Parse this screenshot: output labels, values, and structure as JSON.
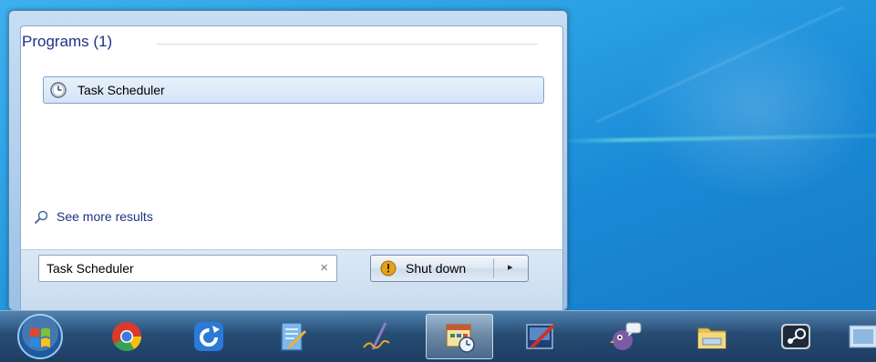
{
  "search_panel": {
    "group_title": "Programs (1)",
    "results": [
      {
        "label": "Task Scheduler",
        "icon": "clock-icon"
      }
    ],
    "see_more_label": "See more results",
    "search_value": "Task Scheduler",
    "clear_glyph": "×",
    "shutdown_label": "Shut down",
    "shutdown_arrow": "▸"
  },
  "taskbar": {
    "items": [
      {
        "name": "start-orb",
        "icon": "windows-start-icon"
      },
      {
        "name": "chrome",
        "icon": "chrome-icon"
      },
      {
        "name": "update-app",
        "icon": "circular-arrow-icon"
      },
      {
        "name": "notepad",
        "icon": "notepad-icon"
      },
      {
        "name": "signature-app",
        "icon": "pen-signature-icon"
      },
      {
        "name": "task-scheduler",
        "icon": "task-scheduler-icon",
        "active": true
      },
      {
        "name": "paint-app",
        "icon": "paint-brush-icon"
      },
      {
        "name": "pidgin",
        "icon": "pidgin-icon"
      },
      {
        "name": "file-explorer",
        "icon": "folder-icon"
      },
      {
        "name": "steam",
        "icon": "steam-icon"
      }
    ]
  },
  "colors": {
    "group_title": "#1e3287",
    "highlight_border": "#7da2ce",
    "desktop": "#2a9fe3"
  }
}
